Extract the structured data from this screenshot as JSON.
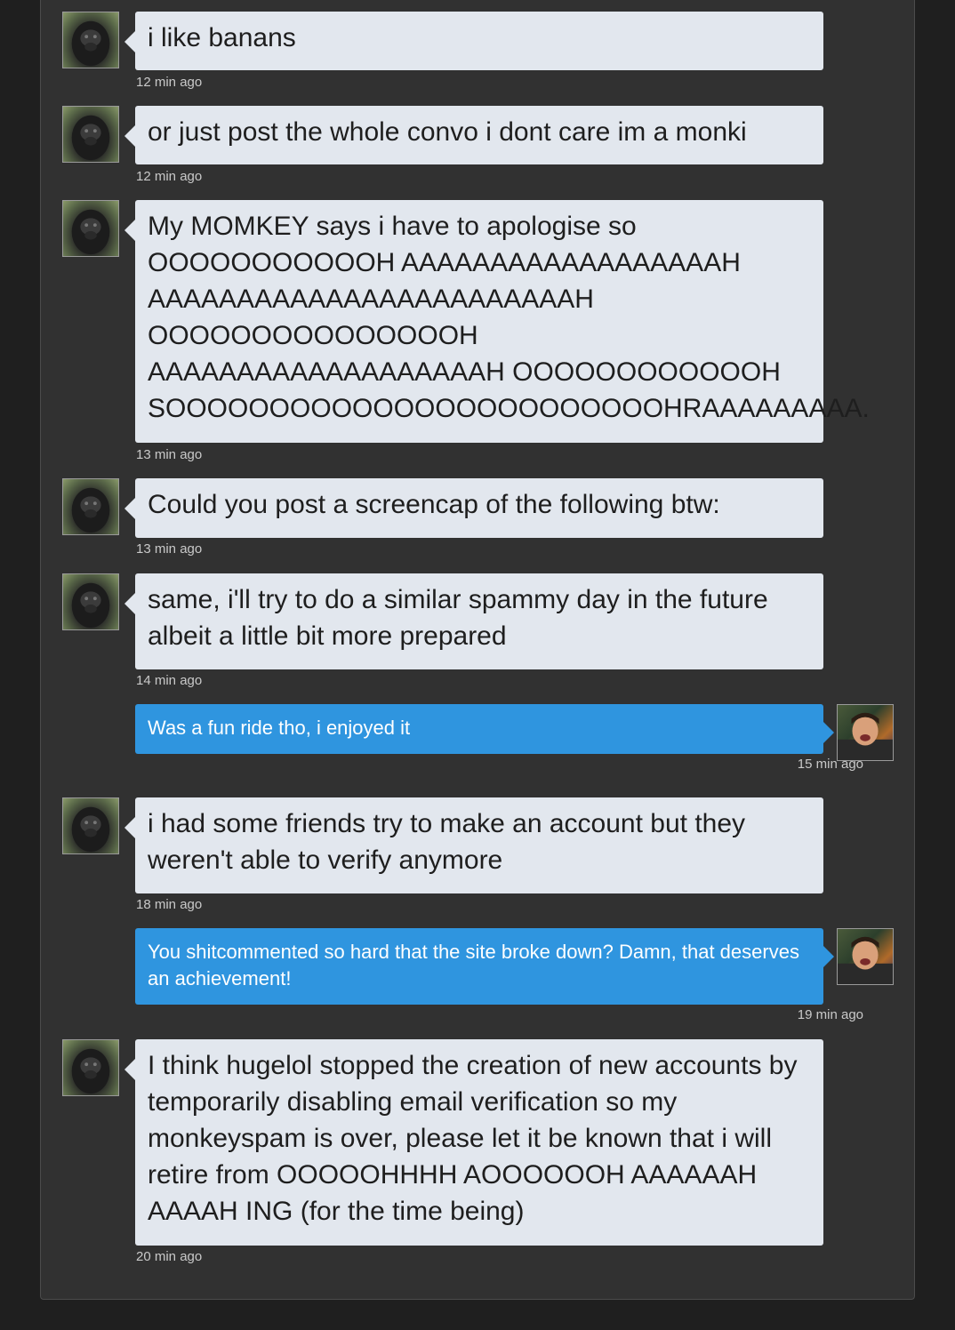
{
  "messages": [
    {
      "side": "in",
      "text": "i like banans",
      "time": "12 min ago"
    },
    {
      "side": "in",
      "text": "or just post the whole convo i dont care im a monki",
      "time": "12 min ago"
    },
    {
      "side": "in",
      "lines": [
        "My MOMKEY says i have to apologise so",
        "OOOOOOOOOOOH AAAAAAAAAAAAAAAAAAH",
        "AAAAAAAAAAAAAAAAAAAAAAAAH",
        "OOOOOOOOOOOOOOOH",
        "AAAAAAAAAAAAAAAAAAAH OOOOOOOOOOOOH",
        "SOOOOOOOOOOOOOOOOOOOOOOOOHRAAAAAAAAA."
      ],
      "time": "13 min ago"
    },
    {
      "side": "in",
      "text": "Could you post a screencap of the following btw:",
      "time": "13 min ago"
    },
    {
      "side": "in",
      "text": "same, i'll try to do a similar spammy day in the future albeit a little bit more prepared",
      "time": "14 min ago"
    },
    {
      "side": "out",
      "text": "Was a fun ride tho, i enjoyed it",
      "time": "15 min ago"
    },
    {
      "side": "in",
      "text": "i had some friends try to make an account but they weren't able to verify anymore",
      "time": "18 min ago"
    },
    {
      "side": "out",
      "text": "You shitcommented so hard that the site broke down? Damn, that deserves an achievement!",
      "time": "19 min ago"
    },
    {
      "side": "in",
      "text": "I think hugelol stopped the creation of new accounts by temporarily disabling email verification so my monkeyspam is over, please let it be known that i will retire from OOOOOHHHH AOOOOOOH AAAAAAH AAAAH ING (for the time being)",
      "time": "20 min ago"
    }
  ]
}
